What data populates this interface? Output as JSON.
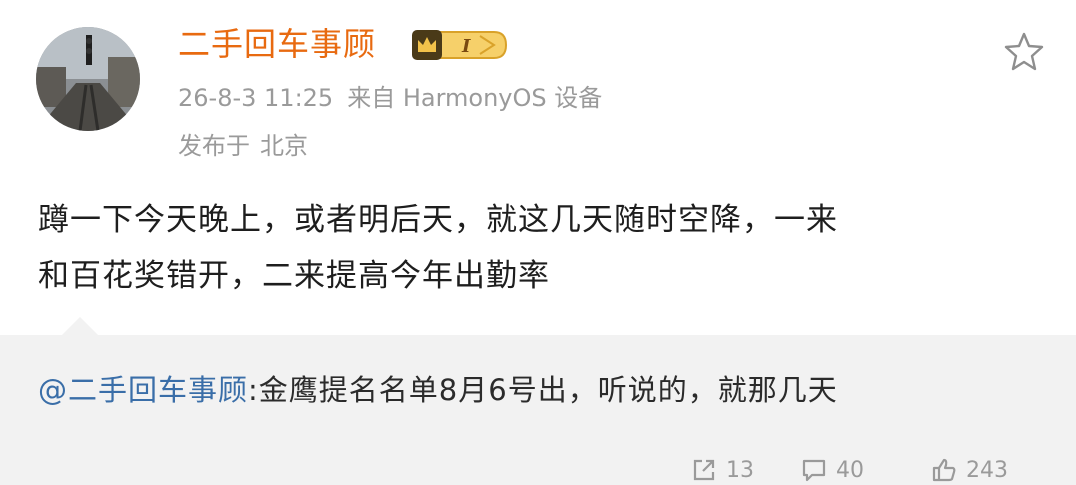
{
  "post": {
    "author": "二手回车事顾",
    "vip_level": "I",
    "timestamp": "26-8-3 11:25",
    "source": "来自 HarmonyOS 设备",
    "location_prefix": "发布于",
    "location": "北京",
    "body_lines": [
      "蹲一下今天晚上，或者明后天，就这几天随时空降，一来",
      "和百花奖错开，二来提高今年出勤率"
    ]
  },
  "repost": {
    "mention": "@二手回车事顾",
    "text": ":金鹰提名名单8月6号出，听说的，就那几天"
  },
  "actions": {
    "share_count": "13",
    "comment_count": "40",
    "like_count": "243"
  },
  "colors": {
    "username": "#e86a10",
    "meta": "#9a9a9a",
    "link": "#3a6ea8",
    "repost_bg": "#f2f2f2",
    "vip_badge": "#f2b632"
  },
  "icons": {
    "favorite": "star-outline-icon",
    "vip": "crown-icon",
    "share": "share-icon",
    "comment": "comment-icon",
    "like": "like-icon"
  }
}
